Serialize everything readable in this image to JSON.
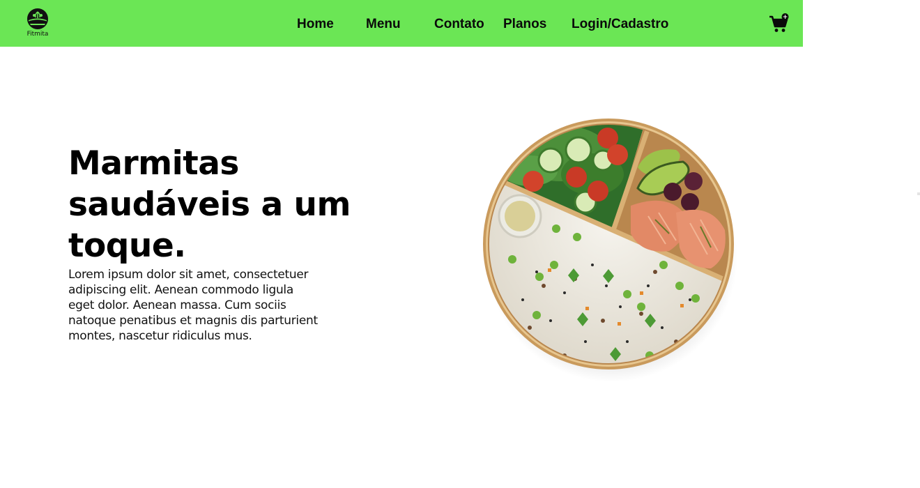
{
  "brand": {
    "name": "Fitmita",
    "color": "#6be655"
  },
  "nav": {
    "links": [
      "Home",
      "Menu",
      "Contato",
      "Planos",
      "Login/Cadastro"
    ]
  },
  "cart": {
    "icon": "shopping-cart-icon",
    "badge": "+"
  },
  "hero": {
    "title": "Marmitas saudáveis a um toque.",
    "text": "Lorem ipsum dolor sit amet, consectetuer adipiscing elit. Aenean commodo ligula eget dolor. Aenean massa. Cum sociis natoque penatibus et magnis dis parturient montes, nascetur ridiculus mus.",
    "image": "meal-bowl-image"
  }
}
